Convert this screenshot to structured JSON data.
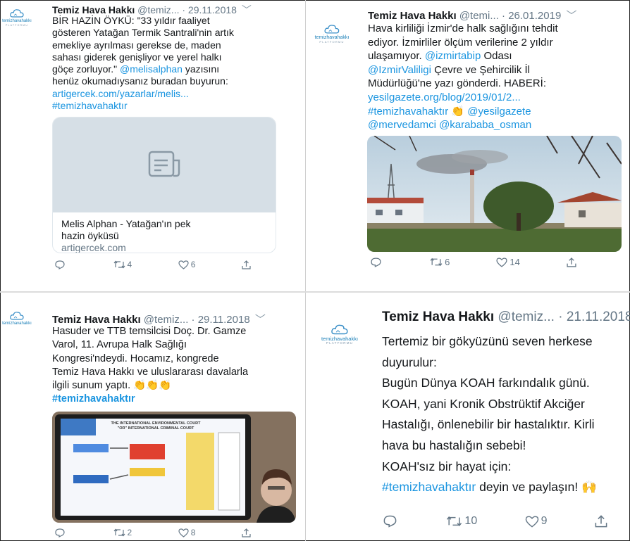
{
  "brand": {
    "name": "temizhavahakkı",
    "sub": "PLATFORMU"
  },
  "colors": {
    "link": "#1b95e0",
    "meta": "#657786",
    "brand": "#1b7fb8"
  },
  "tweets": [
    {
      "name": "Temiz Hava Hakkı",
      "handle": "@temiz...",
      "date": "· 29.11.2018",
      "text": "BİR HAZİN ÖYKÜ: \"33 yıldır faaliyet\ngösteren Yatağan Termik Santrali'nin artık\nemekliye ayrılması gerekse de, maden\nsahası giderek genişliyor ve yerel halkı\ngöçe zorluyor.\"",
      "mention": "@melisalphan",
      "text2": " yazısını\nhenüz okumadıysanız buradan buyurun:",
      "url": "artigercek.com/yazarlar/melis...",
      "hashtag": "#temizhavahaktır",
      "card": {
        "title": "Melis Alphan - Yatağan'ın pek\nhazin öyküsü",
        "domain": "artigercek.com",
        "icon": "document-icon"
      },
      "replies": "",
      "retweets": "4",
      "likes": "6"
    },
    {
      "name": "Temiz Hava Hakkı",
      "handle": "@temi...",
      "date": "· 26.01.2019",
      "line1": "Hava kirliliği İzmir'de halk sağlığını tehdit\nediyor. İzmirliler ölçüm verilerine 2 yıldır\nulaşamıyor. ",
      "mention1": "@izmirtabip",
      "line2": " Odası",
      "mention2": "@IzmirValiligi",
      "line3": " Çevre ve Şehircilik İl\nMüdürlüğü'ne yazı gönderdi. HABERİ:",
      "url": "yesilgazete.org/blog/2019/01/2...",
      "hashtag": "#temizhavahaktır",
      "mention3": "@yesilgazete",
      "mention4": "@mervedamci @karababa_osman",
      "photo": "power-plant-chimney-photo",
      "replies": "",
      "retweets": "6",
      "likes": "14"
    },
    {
      "name": "Temiz Hava Hakkı",
      "handle": "@temiz...",
      "date": "· 29.11.2018",
      "text": "Hasuder ve TTB temsilcisi Doç. Dr. Gamze\nVarol, 11. Avrupa Halk Sağlığı\nKongresi'ndeydi. Hocamız, kongrede\nTemiz Hava Hakkı ve uluslararası davalarla\nilgili sunum yaptı.",
      "hashtag": "#temizhavahaktır",
      "photo_title": "THE INTERNATIONAL ENVIRONMENTAL COURT\n\"OR\" INTERNATIONAL CRIMINAL COURT",
      "replies": "",
      "retweets": "2",
      "likes": "8"
    },
    {
      "name": "Temiz Hava Hakkı",
      "handle": "@temiz...",
      "date": "· 21.11.2018",
      "text": "Tertemiz bir gökyüzünü seven herkese\nduyurulur:\nBugün Dünya KOAH farkındalık günü.\nKOAH, yani Kronik Obstrüktif Akciğer\nHastalığı, önlenebilir bir hastalıktır. Kirli\nhava bu hastalığın sebebi!\nKOAH'sız bir hayat için:",
      "hashtag": "#temizhavahaktır",
      "text2": " deyin ve paylaşın!",
      "replies": "",
      "retweets": "10",
      "likes": "9"
    }
  ]
}
